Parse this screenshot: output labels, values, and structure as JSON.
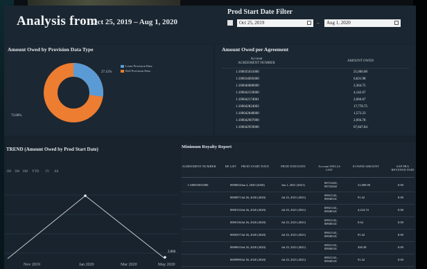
{
  "header": {
    "title": "Analysis from",
    "date_range": "Oct 25, 2019 – Aug 1, 2020",
    "filter_title": "Prod Start Date Filter",
    "filter_start": "Oct 25, 2019",
    "filter_end": "Aug 1, 2020",
    "filter_sep": "–"
  },
  "donut": {
    "title": "Amount Owed by Provision Data Type",
    "legend": [
      "Lease Provision Data",
      "Roll Provision Data"
    ],
    "label_blue": "27.15%",
    "label_orange": "72.88%",
    "colors": {
      "blue": "#5b9bd5",
      "orange": "#ed7d31"
    }
  },
  "agreement": {
    "title": "Amount Owed per Agreement",
    "col1_line1": "Account",
    "col1_line2": "AGREEMENT NUMBER",
    "col2": "AMOUNT OWED",
    "rows": [
      [
        "1.100035031000",
        "21,000.00"
      ],
      [
        "1.100034695000",
        "6,831.98"
      ],
      [
        "1.100040680000",
        "2,364.75"
      ],
      [
        "1.100042159000",
        "4,142.67"
      ],
      [
        "1.100042174001",
        "2,066.67"
      ],
      [
        "1.100042824002",
        "17,778.75"
      ],
      [
        "1.100042848000",
        "1,572.23"
      ],
      [
        "1.100042907000",
        "2,094.78"
      ],
      [
        "1.100042959000",
        "67,847.84"
      ]
    ]
  },
  "trend": {
    "title": "TREND (Amount Owed by Prod Start Date)",
    "ranges": [
      "1M",
      "3M",
      "6M",
      "YTD",
      "1Y",
      "All"
    ],
    "peak_label": "2,066",
    "x_labels": [
      "Nov 2019",
      "Jan 2020",
      "Mar 2020",
      "May 2020"
    ]
  },
  "royalty": {
    "title": "Minimum Royalty Report",
    "headers": [
      "AGREEMENT NUMBER",
      "RP LIST",
      "PROD START DATE",
      "PROD END DATE",
      "Account WELLS LIST",
      "$ OWED AMOUNT",
      "SAP PRA REVENUE PAID"
    ],
    "rows": [
      [
        "1.100035031000",
        "0000034",
        "Jan 2, 2020 (2020)",
        "Jan 1, 2021 (2021)",
        "00721441, 00722442",
        "21,000.00",
        "0.00"
      ],
      [
        "",
        "0000071",
        "Jul 26, 2020 (2020)",
        "Jul 25, 2021 (2021)",
        "00921141, 00940141",
        "91.42",
        "0.00"
      ],
      [
        "",
        "0000133",
        "Jul 26, 2020 (2020)",
        "Jul 25, 2021 (2021)",
        "00921141, 00940141",
        "4,224.74",
        "0.00"
      ],
      [
        "",
        "0000136",
        "Jul 26, 2020 (2020)",
        "Jul 25, 2021 (2021)",
        "00921141, 00940141",
        "0.64",
        "0.00"
      ],
      [
        "",
        "0000257",
        "Jul 26, 2020 (2020)",
        "Jul 25, 2021 (2021)",
        "00921141, 00940141",
        "91.42",
        "0.00"
      ],
      [
        "",
        "0000633",
        "Jul 26, 2020 (2020)",
        "Jul 25, 2021 (2021)",
        "00921141, 00940141",
        "458.38",
        "0.00"
      ],
      [
        "",
        "0000998",
        "Jul 26, 2020 (2020)",
        "Jul 25, 2021 (2021)",
        "00921141, 00940141",
        "91.42",
        "0.00"
      ]
    ]
  }
}
